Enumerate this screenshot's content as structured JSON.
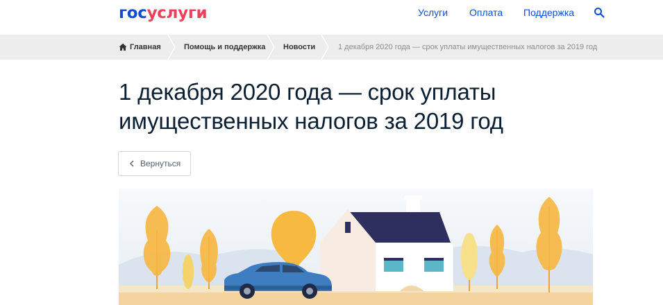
{
  "header": {
    "logo": {
      "part1": "гос",
      "part2": "услуги"
    },
    "nav": [
      {
        "label": "Услуги"
      },
      {
        "label": "Оплата"
      },
      {
        "label": "Поддержка"
      }
    ],
    "search_icon": "search-icon",
    "link_color": "#0d4cd3",
    "logo_accent": "#ee3f58"
  },
  "breadcrumb": {
    "items": [
      {
        "label": "Главная",
        "icon": "home-icon"
      },
      {
        "label": "Помощь и поддержка"
      },
      {
        "label": "Новости"
      }
    ],
    "current": "1 декабря 2020 года — срок уплаты имущественных налогов за 2019 год"
  },
  "article": {
    "title_line1": "1 декабря 2020 года — срок уплаты",
    "title_line2": "имущественных налогов за 2019 год",
    "back_label": "Вернуться"
  }
}
